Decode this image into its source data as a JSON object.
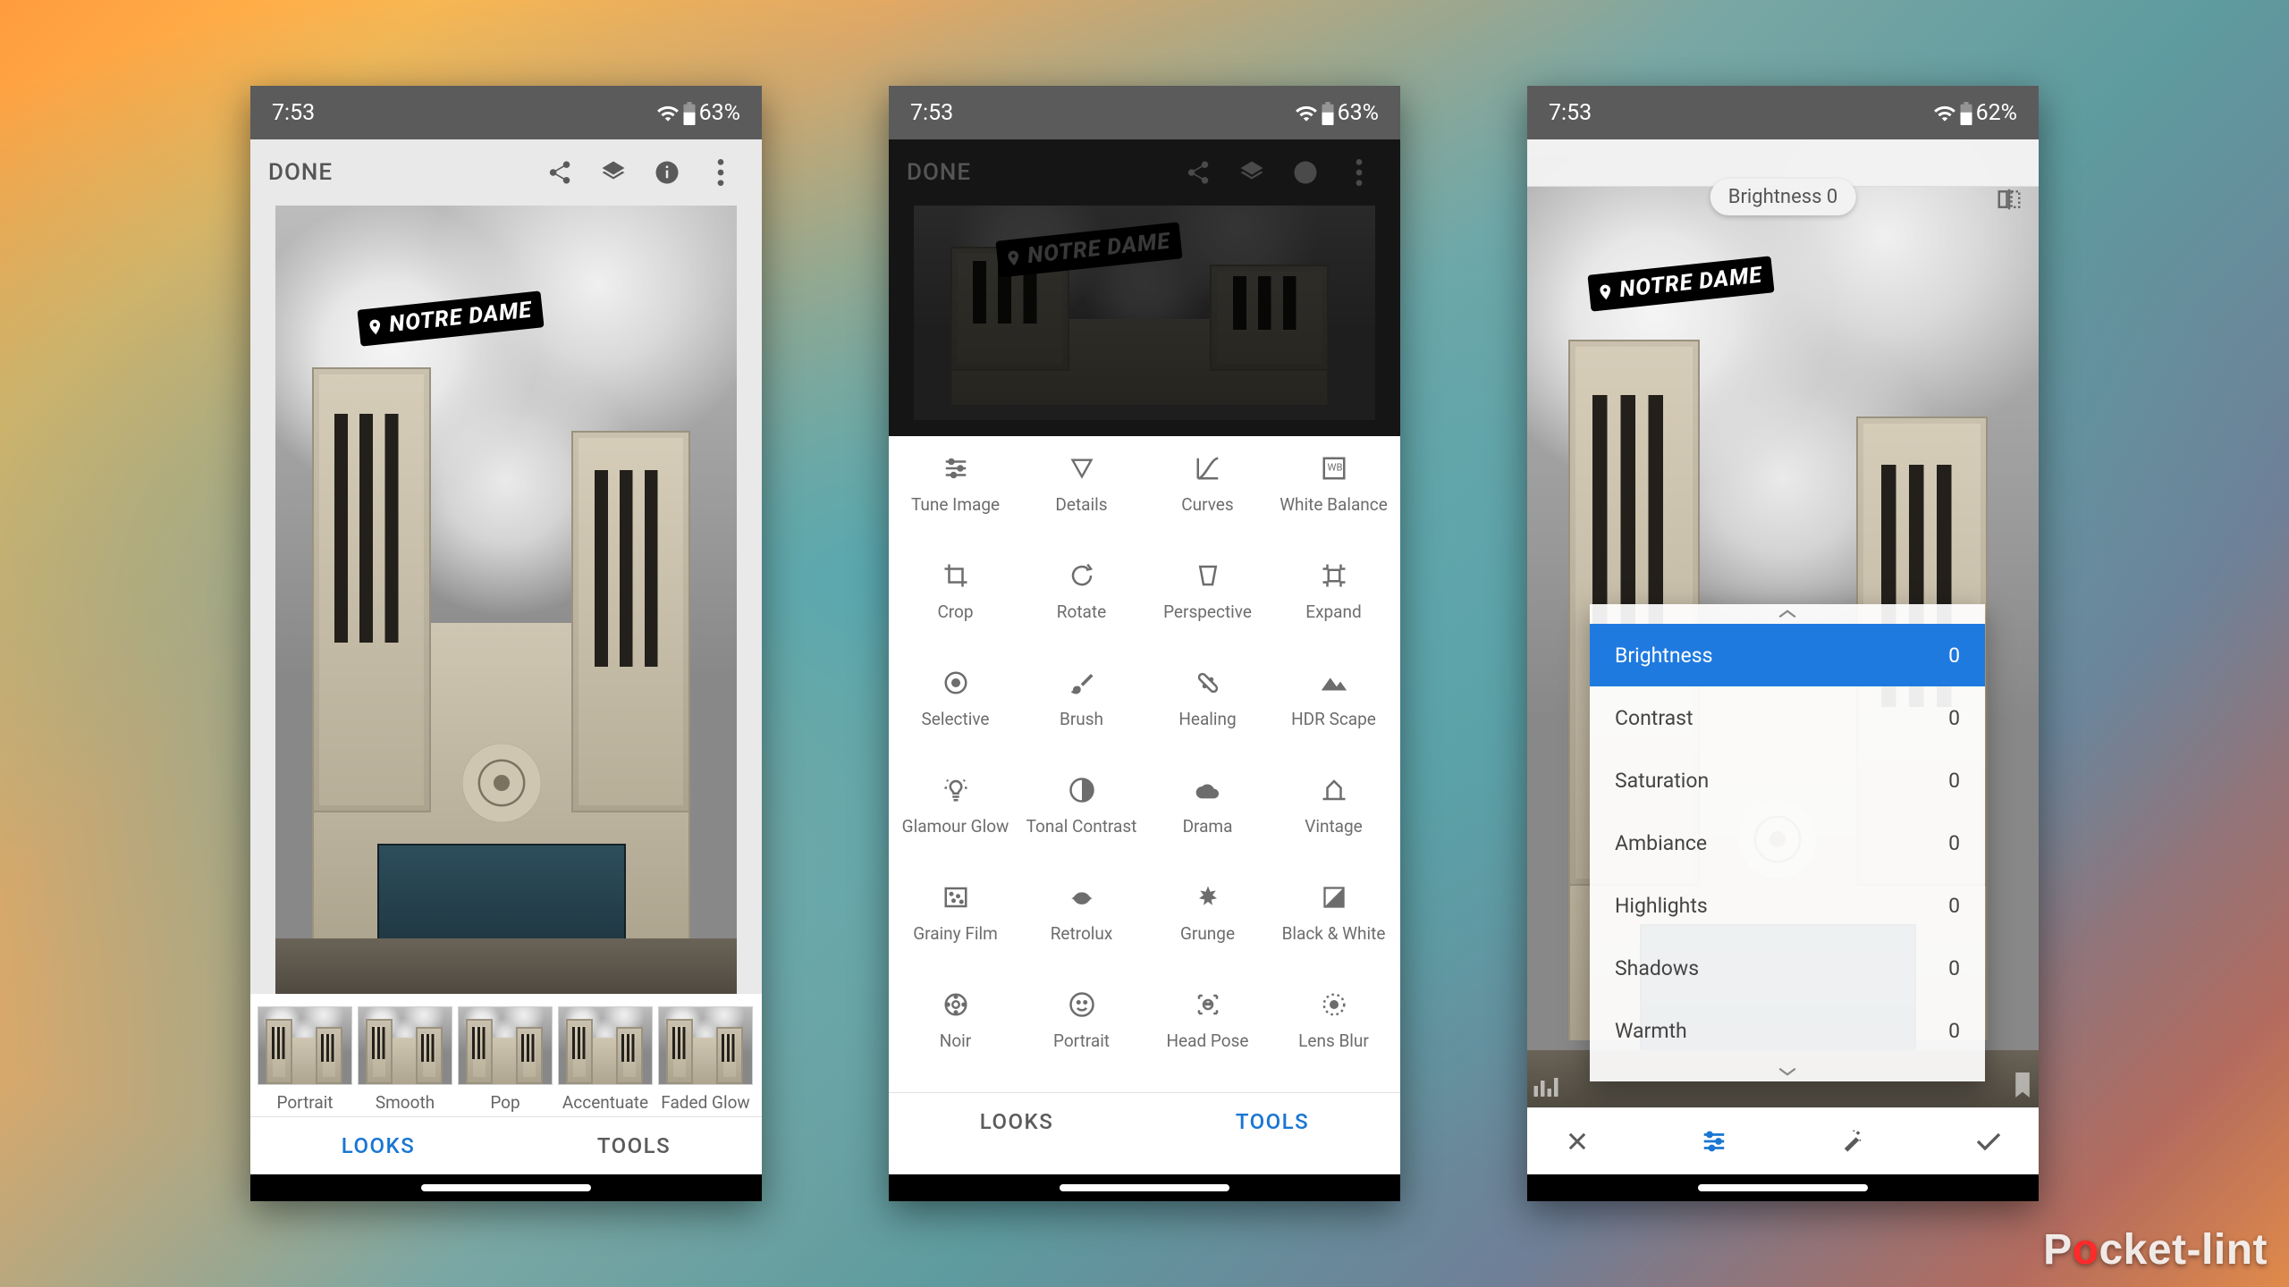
{
  "watermark": {
    "left": "P",
    "o": "o",
    "right": "cket-lint"
  },
  "badge_text": "NOTRE DAME",
  "screens": {
    "a": {
      "status": {
        "time": "7:53",
        "battery": "63%"
      },
      "done": "DONE",
      "looks": [
        {
          "label": "Portrait"
        },
        {
          "label": "Smooth"
        },
        {
          "label": "Pop"
        },
        {
          "label": "Accentuate"
        },
        {
          "label": "Faded Glow"
        }
      ],
      "tabs": {
        "looks": "LOOKS",
        "tools": "TOOLS"
      }
    },
    "b": {
      "status": {
        "time": "7:53",
        "battery": "63%"
      },
      "done": "DONE",
      "tabs": {
        "looks": "LOOKS",
        "tools": "TOOLS"
      },
      "tools": [
        {
          "label": "Tune Image"
        },
        {
          "label": "Details"
        },
        {
          "label": "Curves"
        },
        {
          "label": "White Balance"
        },
        {
          "label": "Crop"
        },
        {
          "label": "Rotate"
        },
        {
          "label": "Perspective"
        },
        {
          "label": "Expand"
        },
        {
          "label": "Selective"
        },
        {
          "label": "Brush"
        },
        {
          "label": "Healing"
        },
        {
          "label": "HDR Scape"
        },
        {
          "label": "Glamour Glow"
        },
        {
          "label": "Tonal Contrast"
        },
        {
          "label": "Drama"
        },
        {
          "label": "Vintage"
        },
        {
          "label": "Grainy Film"
        },
        {
          "label": "Retrolux"
        },
        {
          "label": "Grunge"
        },
        {
          "label": "Black & White"
        },
        {
          "label": "Noir"
        },
        {
          "label": "Portrait"
        },
        {
          "label": "Head Pose"
        },
        {
          "label": "Lens Blur"
        }
      ]
    },
    "c": {
      "status": {
        "time": "7:53",
        "battery": "62%"
      },
      "chip": "Brightness 0",
      "sliders": [
        {
          "name": "Brightness",
          "value": "0",
          "selected": true
        },
        {
          "name": "Contrast",
          "value": "0"
        },
        {
          "name": "Saturation",
          "value": "0"
        },
        {
          "name": "Ambiance",
          "value": "0"
        },
        {
          "name": "Highlights",
          "value": "0"
        },
        {
          "name": "Shadows",
          "value": "0"
        },
        {
          "name": "Warmth",
          "value": "0"
        }
      ]
    }
  }
}
